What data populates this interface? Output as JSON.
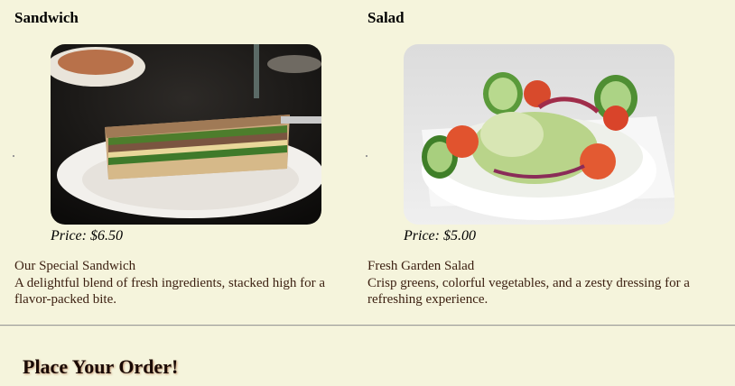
{
  "menu": {
    "items": [
      {
        "title": "Sandwich",
        "image": "sandwich-photo",
        "price": "Price: $6.50",
        "name": "Our Special Sandwich",
        "description": "A delightful blend of fresh ingredients, stacked high for a flavor-packed bite."
      },
      {
        "title": "Salad",
        "image": "salad-photo",
        "price": "Price: $5.00",
        "name": "Fresh Garden Salad",
        "description": "Crisp greens, colorful vegetables, and a zesty dressing for a refreshing experience."
      }
    ]
  },
  "order": {
    "heading": "Place Your Order!"
  },
  "colors": {
    "background": "#f5f4dc",
    "text": "#3b1f10",
    "divider": "#9a9a9a"
  }
}
